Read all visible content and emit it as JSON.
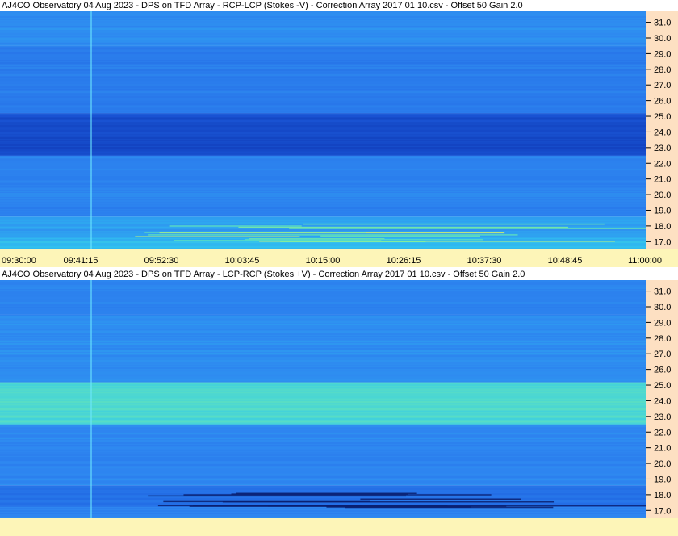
{
  "chart_data": [
    {
      "type": "heatmap",
      "title": "AJ4CO Observatory 04 Aug 2023  -  DPS on TFD Array  -  RCP-LCP (Stokes -V)  -  Correction Array 2017 01 10.csv  -  Offset 50  Gain 2.0",
      "x_ticks": [
        "09:30:00",
        "09:41:15",
        "09:52:30",
        "10:03:45",
        "10:15:00",
        "10:26:15",
        "10:37:30",
        "10:48:45",
        "11:00:00"
      ],
      "y_ticks": [
        31.0,
        30.0,
        29.0,
        28.0,
        27.0,
        26.0,
        25.0,
        24.0,
        23.0,
        22.0,
        21.0,
        20.0,
        19.0,
        18.0,
        17.0
      ],
      "ylim": [
        16.5,
        31.7
      ],
      "colormap": [
        "#0a2fa8",
        "#1e5fe0",
        "#2e86f0",
        "#30c8f0",
        "#7cf0a0",
        "#e8f060"
      ],
      "bands": [
        {
          "lo": 16.5,
          "hi": 17.3,
          "level": 0.55
        },
        {
          "lo": 17.3,
          "hi": 18.6,
          "level": 0.48
        },
        {
          "lo": 18.6,
          "hi": 22.5,
          "level": 0.38
        },
        {
          "lo": 22.5,
          "hi": 25.2,
          "level": 0.12
        },
        {
          "lo": 25.2,
          "hi": 29.5,
          "level": 0.35
        },
        {
          "lo": 29.5,
          "hi": 31.7,
          "level": 0.42
        }
      ]
    },
    {
      "type": "heatmap",
      "title": "AJ4CO Observatory 04 Aug 2023  -  DPS on TFD Array  -  LCP-RCP (Stokes +V)  -  Correction Array 2017 01 10.csv  -  Offset 50  Gain 2.0",
      "y_ticks": [
        31.0,
        30.0,
        29.0,
        28.0,
        27.0,
        26.0,
        25.0,
        24.0,
        23.0,
        22.0,
        21.0,
        20.0,
        19.0,
        18.0,
        17.0
      ],
      "ylim": [
        16.5,
        31.7
      ],
      "colormap": [
        "#0a2fa8",
        "#1e5fe0",
        "#2e86f0",
        "#30c8f0",
        "#7cf0a0",
        "#e8f060"
      ],
      "bands": [
        {
          "lo": 16.5,
          "hi": 17.3,
          "level": 0.4
        },
        {
          "lo": 17.3,
          "hi": 18.6,
          "level": 0.3
        },
        {
          "lo": 18.6,
          "hi": 22.5,
          "level": 0.4
        },
        {
          "lo": 22.5,
          "hi": 25.2,
          "level": 0.68
        },
        {
          "lo": 25.2,
          "hi": 29.5,
          "level": 0.42
        },
        {
          "lo": 29.5,
          "hi": 31.7,
          "level": 0.38
        }
      ]
    }
  ]
}
